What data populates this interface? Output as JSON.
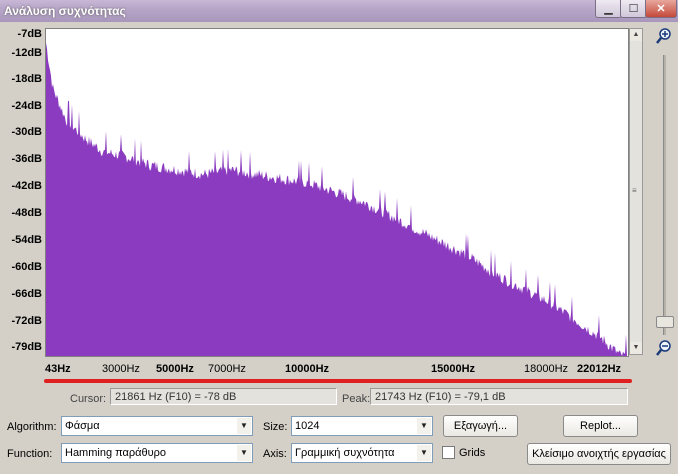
{
  "window": {
    "title": "Ανάλυση συχνότητας",
    "min_glyph": "▁",
    "max_glyph": "☐",
    "close_glyph": "✕"
  },
  "y_ticks": [
    "-7dB",
    "-12dB",
    "-18dB",
    "-24dB",
    "-30dB",
    "-36dB",
    "-42dB",
    "-48dB",
    "-54dB",
    "-60dB",
    "-66dB",
    "-72dB",
    "-79dB"
  ],
  "x_ticks": [
    {
      "label": "43Hz",
      "bold": true
    },
    {
      "label": "3000Hz",
      "bold": false
    },
    {
      "label": "5000Hz",
      "bold": true
    },
    {
      "label": "7000Hz",
      "bold": false
    },
    {
      "label": "10000Hz",
      "bold": true
    },
    {
      "label": "15000Hz",
      "bold": true
    },
    {
      "label": "18000Hz",
      "bold": false
    },
    {
      "label": "22012Hz",
      "bold": true
    }
  ],
  "chart_data": {
    "type": "area",
    "fill_color": "#8a3bbf",
    "xlim": [
      43,
      22012
    ],
    "ylim": [
      -79,
      -7
    ],
    "x_scale": "linear",
    "x": [
      43,
      300,
      800,
      1500,
      2200,
      3000,
      4000,
      5000,
      6000,
      7000,
      8000,
      9000,
      10000,
      11000,
      12000,
      13000,
      14000,
      15000,
      16000,
      17000,
      18000,
      19000,
      20000,
      21000,
      21743,
      22012
    ],
    "values": [
      -10,
      -20,
      -27,
      -31,
      -34,
      -35,
      -37,
      -38,
      -39,
      -38,
      -39,
      -40,
      -41,
      -43,
      -45,
      -48,
      -51,
      -54,
      -57,
      -61,
      -64,
      -67,
      -71,
      -75,
      -79,
      -79
    ],
    "grid": false
  },
  "readouts": {
    "cursor_label": "Cursor:",
    "cursor_value": "21861 Hz (F10) = -78 dB",
    "peak_label": "Peak:",
    "peak_value": "21743 Hz (F10) = -79,1 dB"
  },
  "controls": {
    "algorithm_label": "Algorithm:",
    "algorithm_value": "Φάσμα",
    "size_label": "Size:",
    "size_value": "1024",
    "export_button": "Εξαγωγή...",
    "replot_button": "Replot...",
    "function_label": "Function:",
    "function_value": "Hamming παράθυρο",
    "axis_label": "Axis:",
    "axis_value": "Γραμμική συχνότητα",
    "grids_label": "Grids",
    "grids_checked": false,
    "close_button": "Κλείσιμο ανοιχτής εργασίας"
  }
}
